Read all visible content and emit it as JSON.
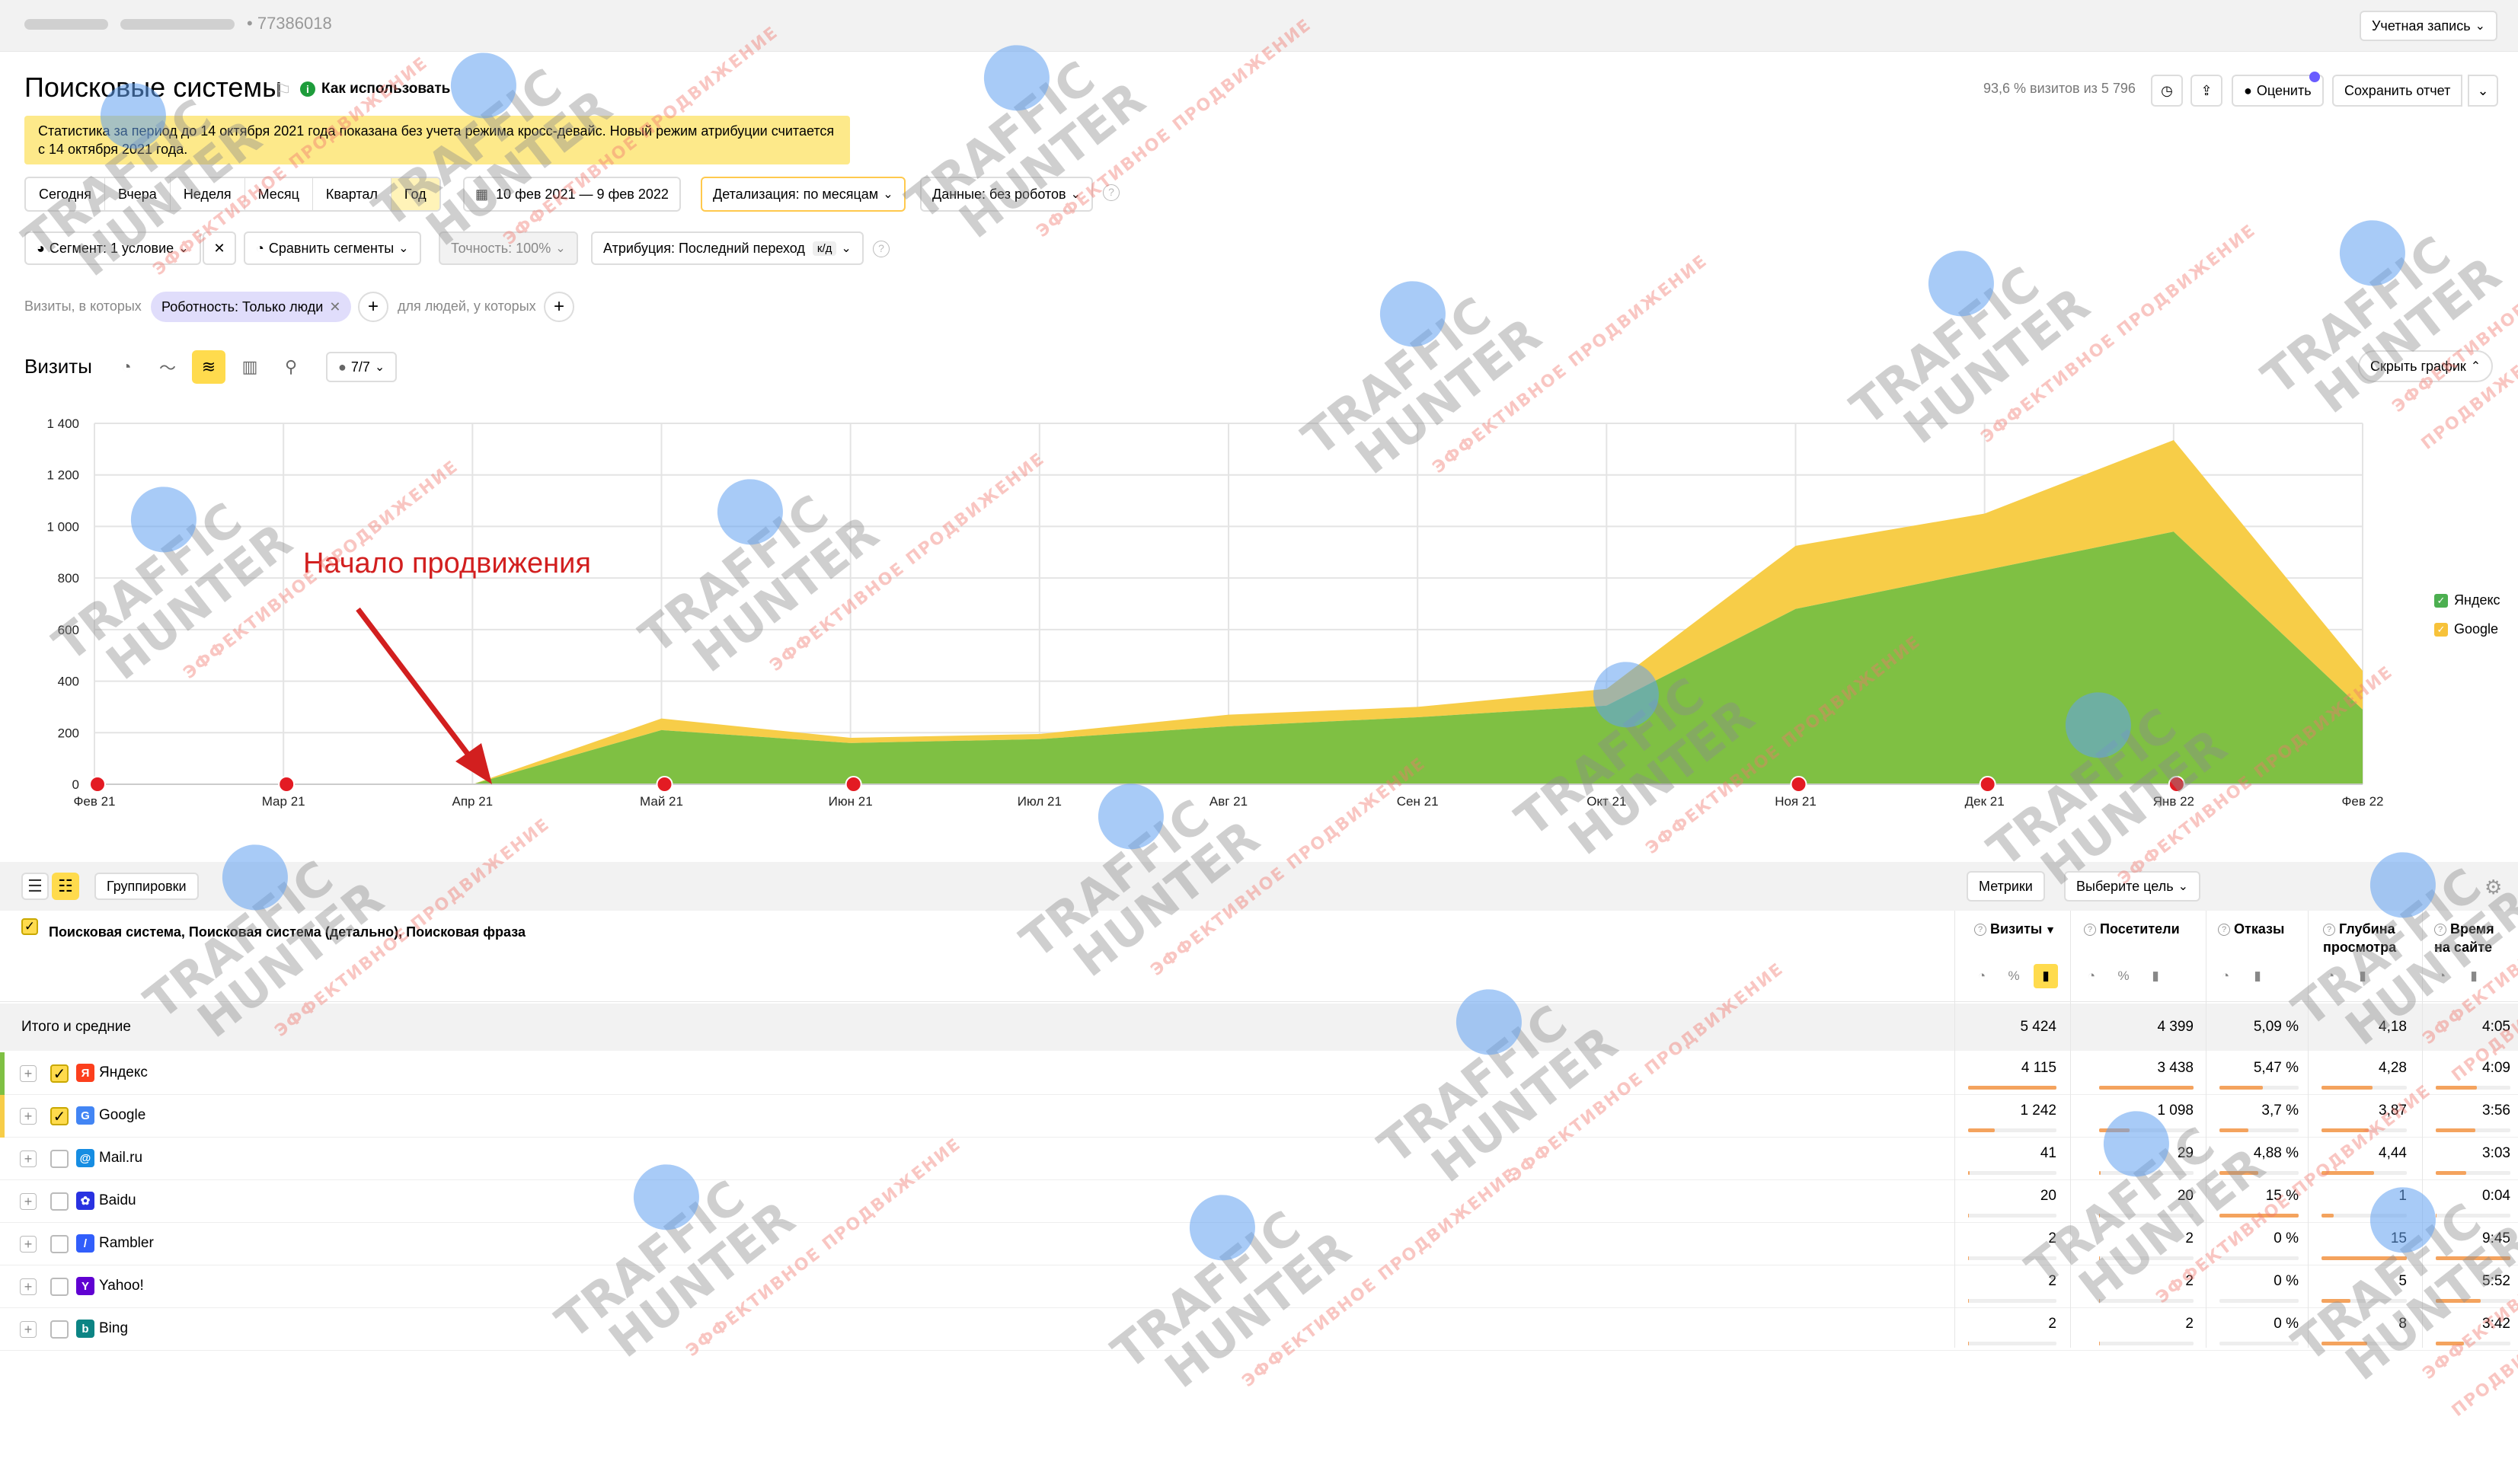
{
  "topbar": {
    "counter_id": "77386018",
    "account_label": "Учетная запись"
  },
  "header": {
    "title": "Поисковые системы",
    "howto": "Как использовать",
    "visits_share": "93,6 % визитов из 5 796",
    "rate_label": "Оценить",
    "save_report": "Сохранить отчет"
  },
  "notice": "Статистика за период до 14 октября 2021 года показана без учета режима кросс-девайс. Новый режим атрибуции считается с 14 октября 2021 года.",
  "periods": [
    "Сегодня",
    "Вчера",
    "Неделя",
    "Месяц",
    "Квартал",
    "Год"
  ],
  "active_period": "Год",
  "date_range": "10 фев 2021 — 9 фев 2022",
  "detail": "Детализация: по месяцам",
  "data_filter": "Данные: без роботов",
  "segment": "Сегмент: 1 условие",
  "compare": "Сравнить сегменты",
  "accuracy": "Точность: 100%",
  "attribution": "Атрибуция: Последний переход",
  "attribution_badge": "к/д",
  "filter": {
    "prefix": "Визиты, в которых",
    "chip": "Роботность: Только люди",
    "people_label": "для людей, у которых"
  },
  "chart_section": {
    "title": "Визиты",
    "series_count": "7/7",
    "hide_label": "Скрыть график",
    "annotation": "Начало продвижения"
  },
  "chart_data": {
    "type": "area",
    "stacked": true,
    "categories": [
      "Фев 21",
      "Мар 21",
      "Апр 21",
      "Май 21",
      "Июн 21",
      "Июл 21",
      "Авг 21",
      "Сен 21",
      "Окт 21",
      "Ноя 21",
      "Дек 21",
      "Янв 22",
      "Фев 22"
    ],
    "yticks": [
      "0",
      "200",
      "400",
      "600",
      "800",
      "1 000",
      "1 200",
      "1 400"
    ],
    "ylim": [
      0,
      1400
    ],
    "series": [
      {
        "name": "Яндекс",
        "color": "#7fc043",
        "values": [
          0,
          0,
          0,
          210,
          160,
          175,
          225,
          260,
          305,
          680,
          830,
          980,
          290
        ]
      },
      {
        "name": "Google",
        "color": "#f7cd48",
        "values": [
          0,
          0,
          0,
          45,
          20,
          20,
          45,
          40,
          65,
          245,
          220,
          355,
          150
        ]
      }
    ],
    "legend": "right",
    "grid": true
  },
  "table": {
    "groupings_label": "Группировки",
    "metrics_label": "Метрики",
    "goal_label": "Выберите цель",
    "dimension_header": "Поисковая система, Поисковая система (детально), Поисковая фраза",
    "columns": [
      {
        "l1": "Визиты",
        "l2": "",
        "sort": "▼"
      },
      {
        "l1": "Посетители",
        "l2": "",
        "sort": ""
      },
      {
        "l1": "Отказы",
        "l2": "",
        "sort": ""
      },
      {
        "l1": "Глубина",
        "l2": "просмотра",
        "sort": ""
      },
      {
        "l1": "Время",
        "l2": "на сайте",
        "sort": ""
      }
    ],
    "totals": {
      "label": "Итого и средние",
      "values": [
        "5 424",
        "4 399",
        "5,09 %",
        "4,18",
        "4:05"
      ]
    },
    "rows": [
      {
        "name": "Яндекс",
        "icon": "Я",
        "icon_color": "#fc3f1d",
        "checked": true,
        "mark": "#7fc043",
        "values": [
          "4 115",
          "3 438",
          "5,47 %",
          "4,28",
          "4:09"
        ],
        "bars": [
          1,
          1,
          0.55,
          0.6,
          0.55
        ]
      },
      {
        "name": "Google",
        "icon": "G",
        "icon_color": "#4285f4",
        "checked": true,
        "mark": "#f7cd48",
        "values": [
          "1 242",
          "1 098",
          "3,7 %",
          "3,87",
          "3:56"
        ],
        "bars": [
          0.3,
          0.32,
          0.37,
          0.55,
          0.53
        ]
      },
      {
        "name": "Mail.ru",
        "icon": "@",
        "icon_color": "#168de2",
        "checked": false,
        "mark": "",
        "values": [
          "41",
          "29",
          "4,88 %",
          "4,44",
          "3:03"
        ],
        "bars": [
          0.02,
          0.02,
          0.49,
          0.62,
          0.41
        ]
      },
      {
        "name": "Baidu",
        "icon": "✿",
        "icon_color": "#2932e1",
        "checked": false,
        "mark": "",
        "values": [
          "20",
          "20",
          "15 %",
          "1",
          "0:04"
        ],
        "bars": [
          0.01,
          0.01,
          1,
          0.14,
          0.01
        ]
      },
      {
        "name": "Rambler",
        "icon": "/",
        "icon_color": "#315efb",
        "checked": false,
        "mark": "",
        "values": [
          "2",
          "2",
          "0 %",
          "15",
          "9:45"
        ],
        "bars": [
          0.005,
          0.005,
          0,
          1,
          1
        ]
      },
      {
        "name": "Yahoo!",
        "icon": "Y",
        "icon_color": "#6001d2",
        "checked": false,
        "mark": "",
        "values": [
          "2",
          "2",
          "0 %",
          "5",
          "5:52"
        ],
        "bars": [
          0.005,
          0.005,
          0,
          0.34,
          0.6
        ]
      },
      {
        "name": "Bing",
        "icon": "b",
        "icon_color": "#0c8484",
        "checked": false,
        "mark": "",
        "values": [
          "2",
          "2",
          "0 %",
          "8",
          "3:42"
        ],
        "bars": [
          0.005,
          0.005,
          0,
          0.54,
          0.38
        ]
      }
    ]
  },
  "watermark": {
    "line1": "TRAFFIC",
    "line2": "HUNTER",
    "line3": "ЭФФЕКТИВНОЕ ПРОДВИЖЕНИЕ"
  }
}
